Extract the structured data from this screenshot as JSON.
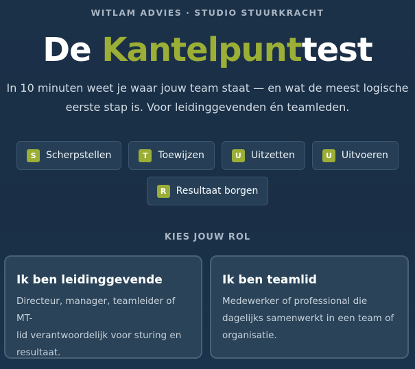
{
  "brand": "WITLAM ADVIES · STUDIO STUURKRACHT",
  "title": {
    "part1": "De ",
    "accent": "Kantelpunt",
    "part2": "test"
  },
  "intro": {
    "line1": "In 10 minuten weet je waar jouw team staat — en wat de meest logische",
    "line2": "eerste stap is. Voor leidinggevenden én teamleden."
  },
  "steps": [
    {
      "letter": "S",
      "label": "Scherpstellen"
    },
    {
      "letter": "T",
      "label": "Toewijzen"
    },
    {
      "letter": "U",
      "label": "Uitzetten"
    },
    {
      "letter": "U",
      "label": "Uitvoeren"
    },
    {
      "letter": "R",
      "label": "Resultaat borgen"
    }
  ],
  "role_section": {
    "label": "KIES JOUW ROL"
  },
  "roles": [
    {
      "title": "Ik ben leidinggevende",
      "desc_lines": [
        "Directeur, manager, teamleider of MT-",
        "lid verantwoordelijk voor sturing en",
        "resultaat."
      ]
    },
    {
      "title": "Ik ben teamlid",
      "desc_lines": [
        "Medewerker of professional die",
        "dagelijks samenwerkt in een team of",
        "organisatie."
      ]
    }
  ],
  "colors": {
    "accent": "#9bae35",
    "background": "#1b3148"
  }
}
